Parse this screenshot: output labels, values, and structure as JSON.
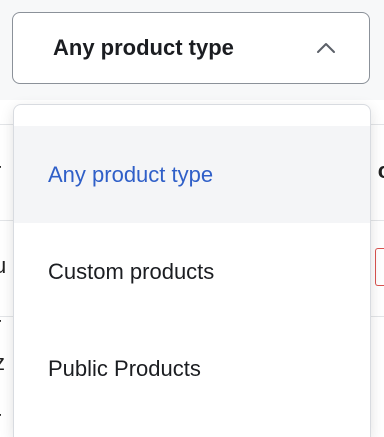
{
  "filter": {
    "selected_label": "Any product type",
    "expanded": true,
    "chevron_icon": "chevron-up-icon"
  },
  "menu": {
    "options": [
      {
        "label": "Any product type",
        "selected": true
      },
      {
        "label": "Custom products",
        "selected": false
      },
      {
        "label": "Public Products",
        "selected": false
      }
    ]
  },
  "colors": {
    "selected_text": "#2f5fc8",
    "selected_bg": "#f4f5f7",
    "text": "#1b1d21",
    "border": "#8b9199"
  }
}
